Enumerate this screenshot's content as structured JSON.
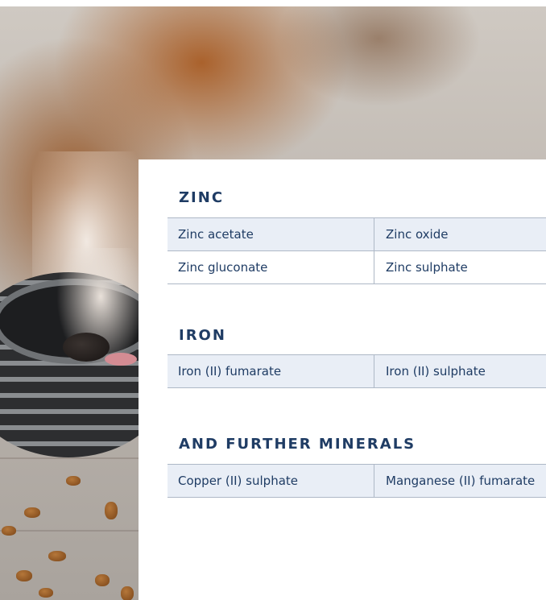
{
  "sections": [
    {
      "title": "ZINC",
      "rows": [
        [
          "Zinc acetate",
          "Zinc oxide"
        ],
        [
          "Zinc gluconate",
          "Zinc sulphate"
        ]
      ]
    },
    {
      "title": "IRON",
      "rows": [
        [
          "Iron (II) fumarate",
          "Iron (II) sulphate"
        ]
      ]
    },
    {
      "title": "AND FURTHER MINERALS",
      "rows": [
        [
          "Copper (II) sulphate",
          "Manganese (II) fumarate"
        ]
      ]
    }
  ],
  "colors": {
    "text": "#1f3c64",
    "row_shade": "#e9eef6",
    "rule": "#aeb8c6"
  }
}
